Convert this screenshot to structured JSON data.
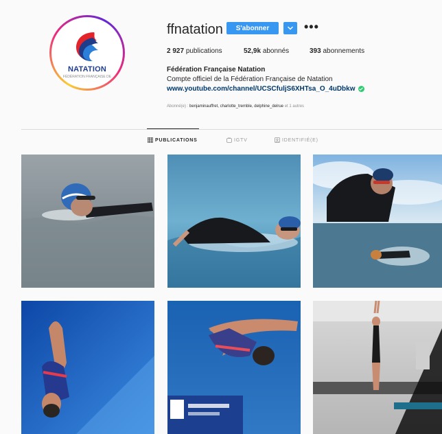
{
  "profile": {
    "username": "ffnatation",
    "follow_label": "S'abonner",
    "more_label": "•••",
    "avatar_text": "NATATION",
    "avatar_subtext": "FÉDÉRATION FRANÇAISE DE",
    "stats": {
      "posts_count": "2 927",
      "posts_label": "publications",
      "followers_count": "52,9k",
      "followers_label": "abonnés",
      "following_count": "393",
      "following_label": "abonnements"
    },
    "full_name": "Fédération Française Natation",
    "bio": "Compte officiel de la Fédération Française de Natation",
    "link": "www.youtube.com/channel/UCSCfuljS6XHTsa_O_4uDbkw",
    "followed_by_prefix": "Abonné(e) :",
    "followed_by_names": "benjaminauffret, charlotte_tremble, delphine_delrue",
    "followed_by_suffix": "et 1 autres"
  },
  "tabs": {
    "publications": "PUBLICATIONS",
    "igtv": "IGTV",
    "tagged": "IDENTIFIÉ(E)"
  },
  "colors": {
    "follow_blue": "#3897f0",
    "link_blue": "#00376b",
    "verify_green": "#2ecc71",
    "background": "#fafafa"
  },
  "posts": [
    {
      "id": 1,
      "subject": "open-water swimmer blue cap"
    },
    {
      "id": 2,
      "subject": "swimmer front crawl wetsuit"
    },
    {
      "id": 3,
      "subject": "open-water swimmers wetsuit"
    },
    {
      "id": 4,
      "subject": "diver pike position"
    },
    {
      "id": 5,
      "subject": "diver tuck position"
    },
    {
      "id": 6,
      "subject": "diver on platform"
    }
  ]
}
